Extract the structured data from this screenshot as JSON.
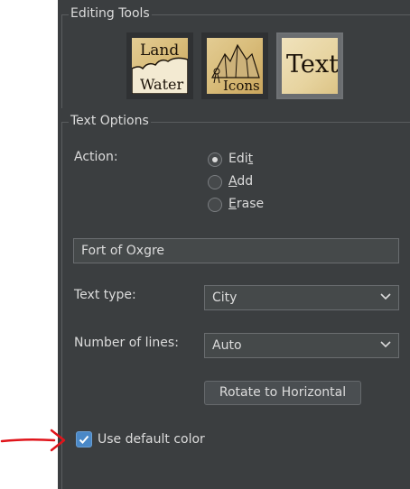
{
  "editing_tools": {
    "title": "Editing Tools",
    "tools": [
      {
        "top": "Land",
        "bottom": "Water"
      },
      {
        "bottom": "Icons"
      },
      {
        "label": "Text"
      }
    ]
  },
  "text_options": {
    "title": "Text Options",
    "action_label": "Action:",
    "actions": [
      {
        "pre": "Edi",
        "mn": "t",
        "post": "",
        "checked": true
      },
      {
        "pre": "",
        "mn": "A",
        "post": "dd",
        "checked": false
      },
      {
        "pre": "",
        "mn": "E",
        "post": "rase",
        "checked": false
      }
    ],
    "text_value": "Fort of Oxgre",
    "text_type_label": "Text type:",
    "text_type_value": "City",
    "lines_label": "Number of lines:",
    "lines_value": "Auto",
    "rotate_button": "Rotate to Horizontal",
    "default_color_label": "Use default color",
    "default_color_checked": true
  },
  "colors": {
    "panel_bg": "#3b3e40",
    "accent": "#4a88c7",
    "annotation_arrow": "#e0141a"
  }
}
